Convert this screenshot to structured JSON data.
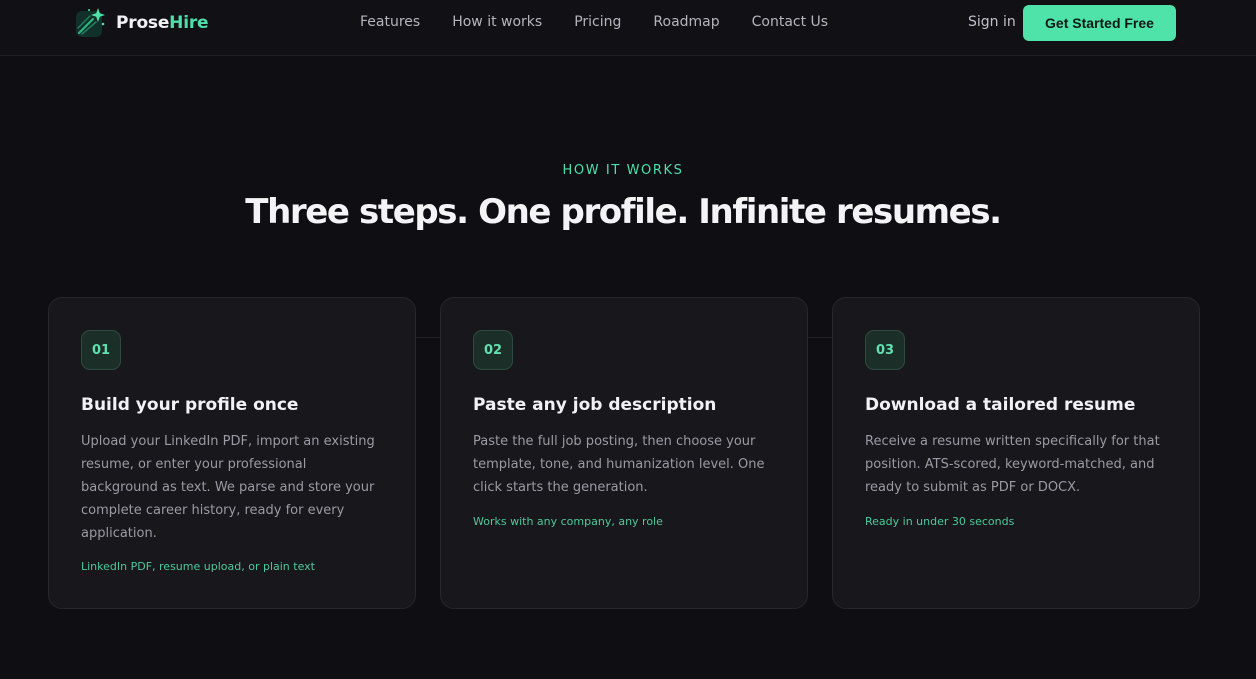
{
  "brand": {
    "name_part1": "Prose",
    "name_part2": "Hire",
    "accent_color": "#4fe3aa",
    "logo_icon": "sparkle-logo-icon"
  },
  "nav": {
    "items": [
      "Features",
      "How it works",
      "Pricing",
      "Roadmap",
      "Contact Us"
    ]
  },
  "auth": {
    "signin_label": "Sign in",
    "cta_label": "Get Started Free"
  },
  "section": {
    "eyebrow": "HOW IT WORKS",
    "headline": "Three steps. One profile. Infinite resumes."
  },
  "steps": [
    {
      "number": "01",
      "title": "Build your profile once",
      "description": "Upload your LinkedIn PDF, import an existing resume, or enter your professional background as text. We parse and store your complete career history, ready for every application.",
      "note": "LinkedIn PDF, resume upload, or plain text"
    },
    {
      "number": "02",
      "title": "Paste any job description",
      "description": "Paste the full job posting, then choose your template, tone, and humanization level. One click starts the generation.",
      "note": "Works with any company, any role"
    },
    {
      "number": "03",
      "title": "Download a tailored resume",
      "description": "Receive a resume written specifically for that position. ATS-scored, keyword-matched, and ready to submit as PDF or DOCX.",
      "note": "Ready in under 30 seconds"
    }
  ]
}
